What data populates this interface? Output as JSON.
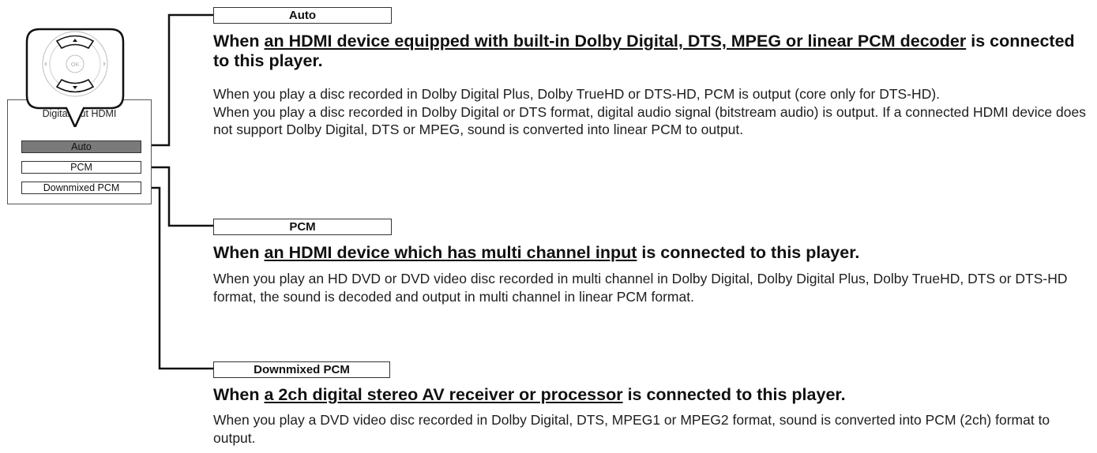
{
  "menu": {
    "title": "Digital Out HDMI",
    "options": [
      "Auto",
      "PCM",
      "Downmixed PCM"
    ],
    "selected": "Auto"
  },
  "remote": {
    "center_label": "OK",
    "icons": [
      "up-arrow-icon",
      "down-arrow-icon",
      "left-arrow-icon",
      "right-arrow-icon"
    ]
  },
  "sections": [
    {
      "label": "Auto",
      "heading_pre": "When ",
      "heading_underlined": "an HDMI device equipped with built-in Dolby Digital, DTS, MPEG or linear PCM decoder",
      "heading_post": " is connected to this player.",
      "paragraphs": [
        "When you play a disc recorded in Dolby Digital Plus, Dolby TrueHD or DTS-HD, PCM is output (core only for DTS-HD).",
        "When you play a disc recorded in Dolby Digital or DTS format, digital audio signal (bitstream audio) is output. If a connected HDMI device does not support Dolby Digital, DTS or MPEG, sound is converted into linear PCM to output."
      ]
    },
    {
      "label": "PCM",
      "heading_pre": "When ",
      "heading_underlined": "an HDMI device which has multi channel input",
      "heading_post": " is connected to this player.",
      "paragraphs": [
        "When you play an HD DVD or DVD video disc recorded in multi channel in Dolby Digital, Dolby Digital Plus, Dolby TrueHD, DTS or DTS-HD format, the sound is decoded and output in multi channel in linear PCM format."
      ]
    },
    {
      "label": "Downmixed PCM",
      "heading_pre": "When ",
      "heading_underlined": "a 2ch digital stereo AV receiver or processor",
      "heading_post": " is connected to this player.",
      "paragraphs": [
        "When you play a DVD video disc recorded in Dolby Digital, DTS, MPEG1 or MPEG2 format, sound is converted into PCM (2ch) format to output."
      ]
    }
  ]
}
